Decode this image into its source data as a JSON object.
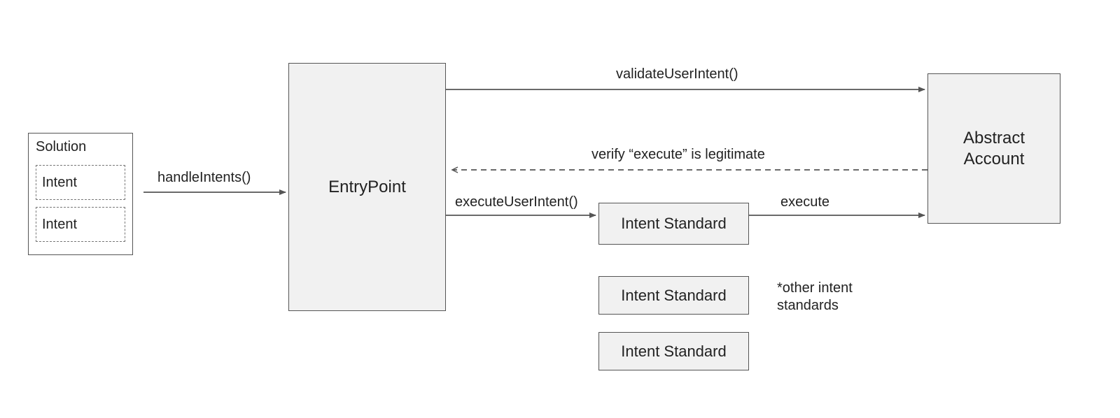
{
  "solution": {
    "title": "Solution",
    "items": [
      "Intent",
      "Intent"
    ]
  },
  "entryPoint": {
    "label": "EntryPoint"
  },
  "abstractAccount": {
    "label": "Abstract\nAccount"
  },
  "intentStandards": {
    "active": "Intent Standard",
    "others": [
      "Intent Standard",
      "Intent Standard"
    ],
    "note": "*other intent\nstandards"
  },
  "arrows": {
    "handleIntents": "handleIntents()",
    "validateUserIntent": "validateUserIntent()",
    "verifyExecute": "verify “execute” is legitimate",
    "executeUserIntent": "executeUserIntent()",
    "execute": "execute"
  }
}
